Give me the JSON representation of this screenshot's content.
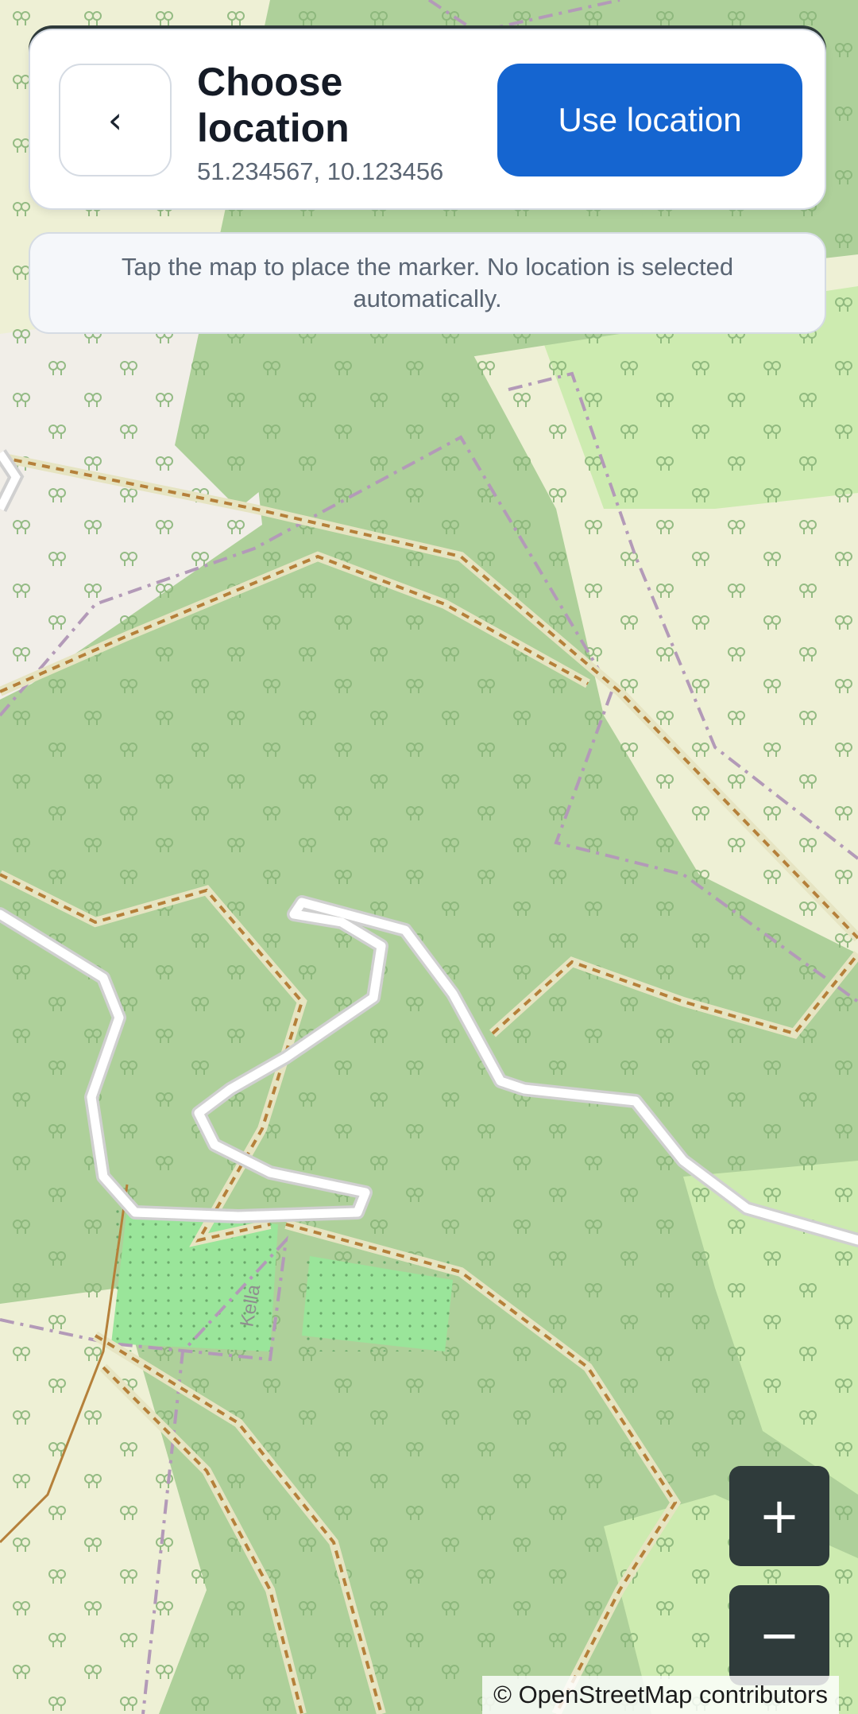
{
  "header": {
    "back_label": "‹",
    "title": "Choose location",
    "coordinates": "51.234567, 10.123456",
    "use_label": "Use location"
  },
  "hint": {
    "text": "Tap the map to place the marker. No location is selected automatically."
  },
  "map": {
    "street_label": "Kella",
    "attribution": "© OpenStreetMap contributors",
    "colors": {
      "forest": "#aed09a",
      "meadow": "#cdebb0",
      "farmland": "#eef0d5",
      "residential": "#f1eee8",
      "road_casing": "#d8d8d8",
      "road": "#ffffff",
      "track": "#b5803a",
      "boundary": "#b39ab8",
      "grass_dots": "#9ae59a"
    }
  },
  "zoom": {
    "in_label": "+",
    "out_label": "−"
  }
}
